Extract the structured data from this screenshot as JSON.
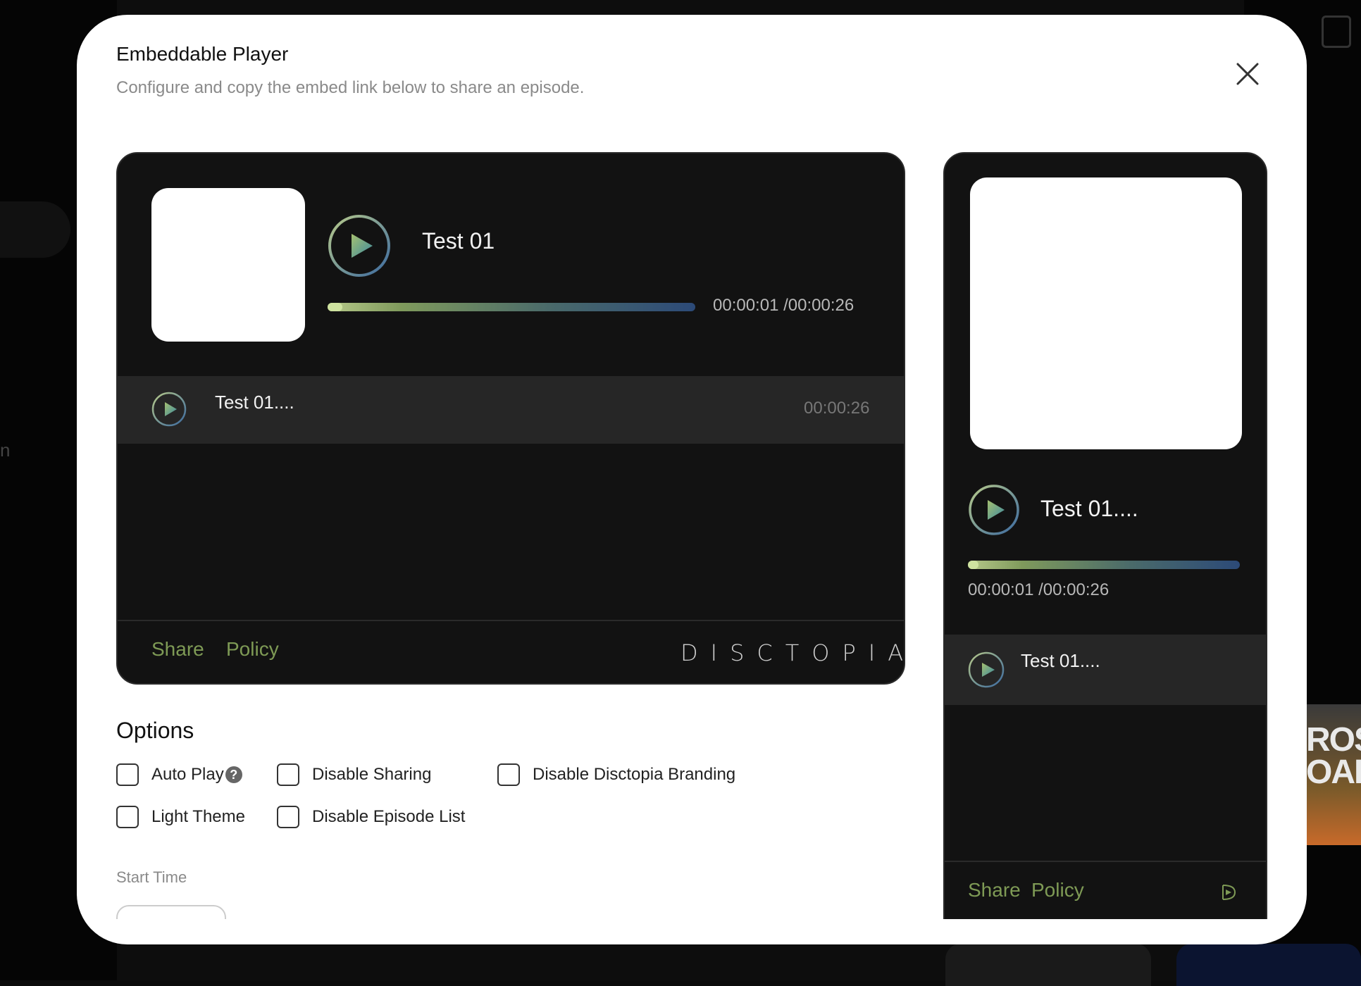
{
  "modal": {
    "title": "Embeddable Player",
    "subtitle": "Configure and copy the embed link below to share an episode."
  },
  "wide_player": {
    "title": "Test 01",
    "progress_fraction": 0.04,
    "time": "00:00:01 /00:00:26",
    "episodes": [
      {
        "title": "Test 01....",
        "duration": "00:00:26"
      }
    ],
    "footer": {
      "share": "Share",
      "policy": "Policy",
      "brand": "DISCTOPIA"
    }
  },
  "options": {
    "heading": "Options",
    "items": [
      {
        "label": "Auto Play",
        "checked": false,
        "help": "?"
      },
      {
        "label": "Disable Sharing",
        "checked": false
      },
      {
        "label": "Disable Disctopia Branding",
        "checked": false
      },
      {
        "label": "Light Theme",
        "checked": false
      },
      {
        "label": "Disable Episode List",
        "checked": false
      }
    ],
    "start_time_label": "Start Time",
    "start_time_value": ""
  },
  "narrow_player": {
    "title": "Test 01....",
    "progress_fraction": 0.04,
    "time": "00:00:01 /00:00:26",
    "episodes": [
      {
        "title": "Test 01...."
      }
    ],
    "footer": {
      "share": "Share",
      "policy": "Policy"
    }
  },
  "background": {
    "card_text": "ROSS\nOADS"
  },
  "colors": {
    "accent_green": "#7e9a55",
    "player_bg": "#121212",
    "episode_row_bg": "#262626",
    "progress_start": "#b7c98a",
    "progress_end": "#2c4a78"
  },
  "icons": {
    "close": "close-icon",
    "play": "play-icon",
    "help": "help-icon",
    "brand_mark": "disctopia-logo-icon"
  }
}
